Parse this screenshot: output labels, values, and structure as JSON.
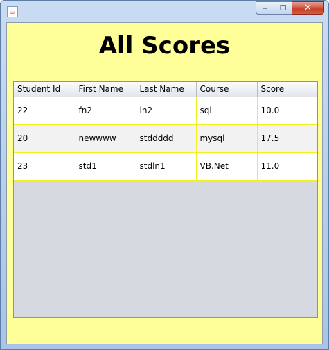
{
  "window": {
    "icon": "java-coffee-icon",
    "buttons": {
      "minimize": "‒",
      "maximize": "☐",
      "close": "✕"
    }
  },
  "page": {
    "title": "All Scores"
  },
  "table": {
    "columns": [
      "Student Id",
      "First Name",
      "Last Name",
      "Course",
      "Score"
    ],
    "rows": [
      [
        "22",
        "fn2",
        "ln2",
        "sql",
        "10.0"
      ],
      [
        "20",
        "newwww",
        "stddddd",
        "mysql",
        "17.5"
      ],
      [
        "23",
        "std1",
        "stdln1",
        "VB.Net",
        "11.0"
      ]
    ]
  },
  "colors": {
    "panel": "#ffff99",
    "grid": "#f2f21a",
    "empty_area": "#d6d9df"
  }
}
